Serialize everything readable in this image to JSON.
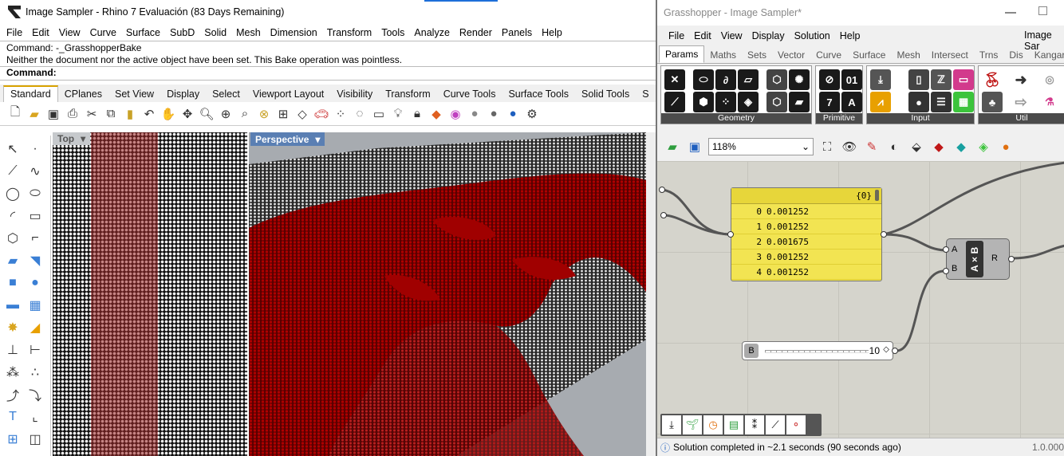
{
  "rhino": {
    "title": "Image Sampler - Rhino 7 Evaluación (83 Days Remaining)",
    "menu": [
      "File",
      "Edit",
      "View",
      "Curve",
      "Surface",
      "SubD",
      "Solid",
      "Mesh",
      "Dimension",
      "Transform",
      "Tools",
      "Analyze",
      "Render",
      "Panels",
      "Help"
    ],
    "command_history": [
      "Command: -_GrasshopperBake",
      "Neither the document nor the active object have been set. This Bake operation was pointless."
    ],
    "command_prompt": "Command:",
    "toolbar_tabs": [
      "Standard",
      "CPlanes",
      "Set View",
      "Display",
      "Select",
      "Viewport Layout",
      "Visibility",
      "Transform",
      "Curve Tools",
      "Surface Tools",
      "Solid Tools",
      "S"
    ],
    "active_tab": "Standard",
    "viewports": {
      "top": "Top",
      "perspective": "Perspective"
    }
  },
  "gh": {
    "title": "Grasshopper - Image Sampler*",
    "menu": [
      "File",
      "Edit",
      "View",
      "Display",
      "Solution",
      "Help"
    ],
    "doc_name": "Image Sar",
    "tabs": [
      "Params",
      "Maths",
      "Sets",
      "Vector",
      "Curve",
      "Surface",
      "Mesh",
      "Intersect",
      "Trns",
      "Dis",
      "Kangar"
    ],
    "active_tab": "Params",
    "panels": [
      "Geometry",
      "Primitive",
      "Input",
      "Util"
    ],
    "zoom": "118%",
    "panel_node": {
      "path": "{0}",
      "rows": [
        {
          "i": "0",
          "v": "0.001252"
        },
        {
          "i": "1",
          "v": "0.001252"
        },
        {
          "i": "2",
          "v": "0.001675"
        },
        {
          "i": "3",
          "v": "0.001252"
        },
        {
          "i": "4",
          "v": "0.001252"
        }
      ]
    },
    "multiply": {
      "label": "A×B",
      "in_a": "A",
      "in_b": "B",
      "out": "R"
    },
    "slider": {
      "name": "B",
      "value": "10",
      "symbol": "◇"
    },
    "status": "Solution completed in ~2.1 seconds (90 seconds ago)",
    "version": "1.0.000"
  }
}
